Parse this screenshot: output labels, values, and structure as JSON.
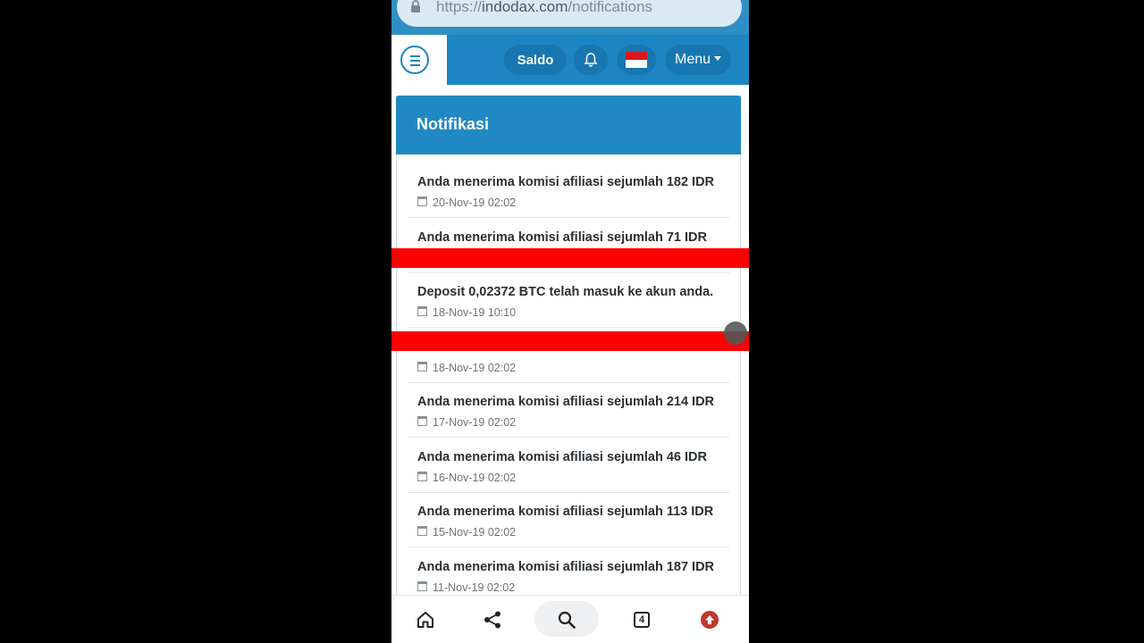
{
  "browser": {
    "url_scheme": "https://",
    "url_host": "indodax.com",
    "url_path": "/notifications"
  },
  "header": {
    "saldo_label": "Saldo",
    "menu_label": "Menu"
  },
  "card": {
    "title": "Notifikasi"
  },
  "notifications": [
    {
      "message": "Anda menerima komisi afiliasi sejumlah 182 IDR",
      "date": "20-Nov-19 02:02"
    },
    {
      "message": "Anda menerima komisi afiliasi sejumlah 71 IDR",
      "date": ""
    },
    {
      "message": "Deposit 0,02372 BTC telah masuk ke akun anda.",
      "date": "18-Nov-19 10:10"
    },
    {
      "message": "",
      "date": "18-Nov-19 02:02"
    },
    {
      "message": "Anda menerima komisi afiliasi sejumlah 214 IDR",
      "date": "17-Nov-19 02:02"
    },
    {
      "message": "Anda menerima komisi afiliasi sejumlah 46 IDR",
      "date": "16-Nov-19 02:02"
    },
    {
      "message": "Anda menerima komisi afiliasi sejumlah 113 IDR",
      "date": "15-Nov-19 02:02"
    },
    {
      "message": "Anda menerima komisi afiliasi sejumlah 187 IDR",
      "date": "11-Nov-19 02:02"
    }
  ],
  "bottom_nav": {
    "tabs_count": "4"
  },
  "colors": {
    "brand_blue": "#1d86c2",
    "redaction": "#ff0000"
  },
  "icons": [
    "lock-icon",
    "hamburger-icon",
    "bell-icon",
    "indonesia-flag-icon",
    "calendar-icon",
    "home-icon",
    "share-icon",
    "search-icon",
    "tabs-icon",
    "upload-icon"
  ]
}
